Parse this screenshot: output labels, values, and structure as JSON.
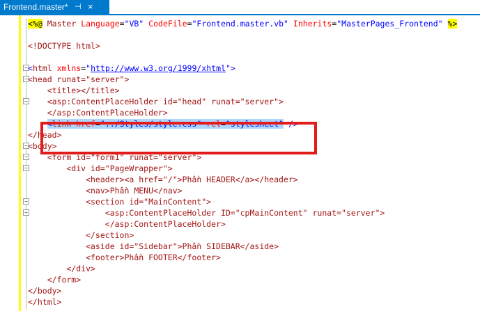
{
  "tab": {
    "title": "Frontend.master*",
    "pin": "⊣",
    "close": "×"
  },
  "code": [
    {
      "text": "<%@ Master Language=\"VB\" CodeFile=\"Frontend.master.vb\" Inherits=\"MasterPages_Frontend\" %>"
    },
    {
      "text": ""
    },
    {
      "text": "<!DOCTYPE html>"
    },
    {
      "text": ""
    },
    {
      "text": "<html xmlns=\"http://www.w3.org/1999/xhtml\">"
    },
    {
      "text": "<head runat=\"server\">"
    },
    {
      "text": "    <title></title>"
    },
    {
      "text": "    <asp:ContentPlaceHolder id=\"head\" runat=\"server\">"
    },
    {
      "text": "    </asp:ContentPlaceHolder>"
    },
    {
      "text": "    <link href=\"../Styles/style.css\" rel=\"stylesheet\" />"
    },
    {
      "text": "</head>"
    },
    {
      "text": "<body>"
    },
    {
      "text": "    <form id=\"form1\" runat=\"server\">"
    },
    {
      "text": "        <div id=\"PageWrapper\">"
    },
    {
      "text": "            <header><a href=\"/\">Phần HEADER</a></header>"
    },
    {
      "text": "            <nav>Phần MENU</nav>"
    },
    {
      "text": "            <section id=\"MainContent\">"
    },
    {
      "text": "                <asp:ContentPlaceHolder ID=\"cpMainContent\" runat=\"server\">"
    },
    {
      "text": "                </asp:ContentPlaceHolder>"
    },
    {
      "text": "            </section>"
    },
    {
      "text": "            <aside id=\"Sidebar\">Phần SIDEBAR</aside>"
    },
    {
      "text": "            <footer>Phần FOOTER</footer>"
    },
    {
      "text": "        </div>"
    },
    {
      "text": "    </form>"
    },
    {
      "text": "</body>"
    },
    {
      "text": "</html>"
    }
  ],
  "colors": {
    "accent": "#007acc",
    "highlight": "#ff0000"
  }
}
